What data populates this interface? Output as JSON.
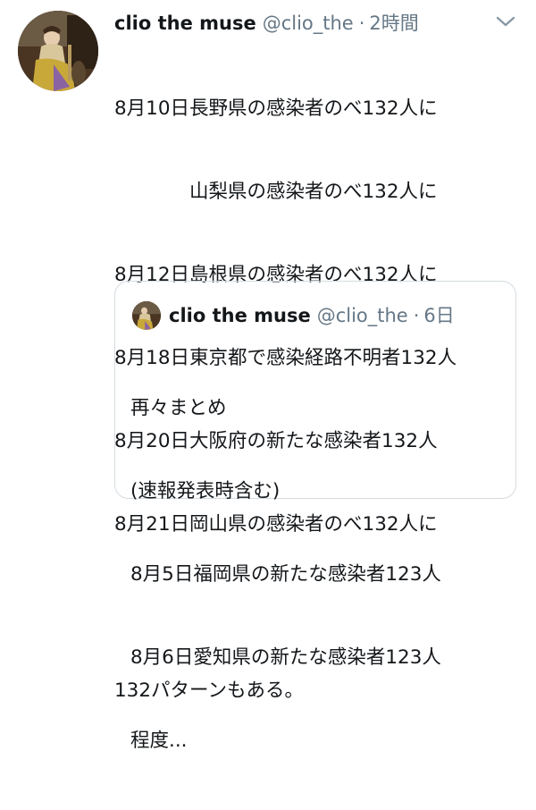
{
  "tweet": {
    "display_name": "clio the muse",
    "handle": "@clio_the",
    "separator": "·",
    "time": "2時間",
    "lines": [
      "8月10日長野県の感染者のべ132人に",
      "山梨県の感染者のべ132人に",
      "8月12日島根県の感染者のべ132人に",
      "8月18日東京都で感染経路不明者132人",
      "8月20日大阪府の新たな感染者132人",
      "8月21日岡山県の感染者のべ132人に",
      "132パターンもある。"
    ],
    "menu_icon": "chevron-down-icon"
  },
  "quoted": {
    "display_name": "clio the muse",
    "handle": "@clio_the",
    "separator": "·",
    "time": "6日",
    "lines": [
      "再々まとめ",
      "(速報発表時含む)",
      "8月5日福岡県の新たな感染者123人",
      "8月6日愛知県の新たな感染者123人",
      "程度..."
    ]
  },
  "colors": {
    "text": "#14171a",
    "secondary": "#657786",
    "border": "#d5dbe0"
  }
}
